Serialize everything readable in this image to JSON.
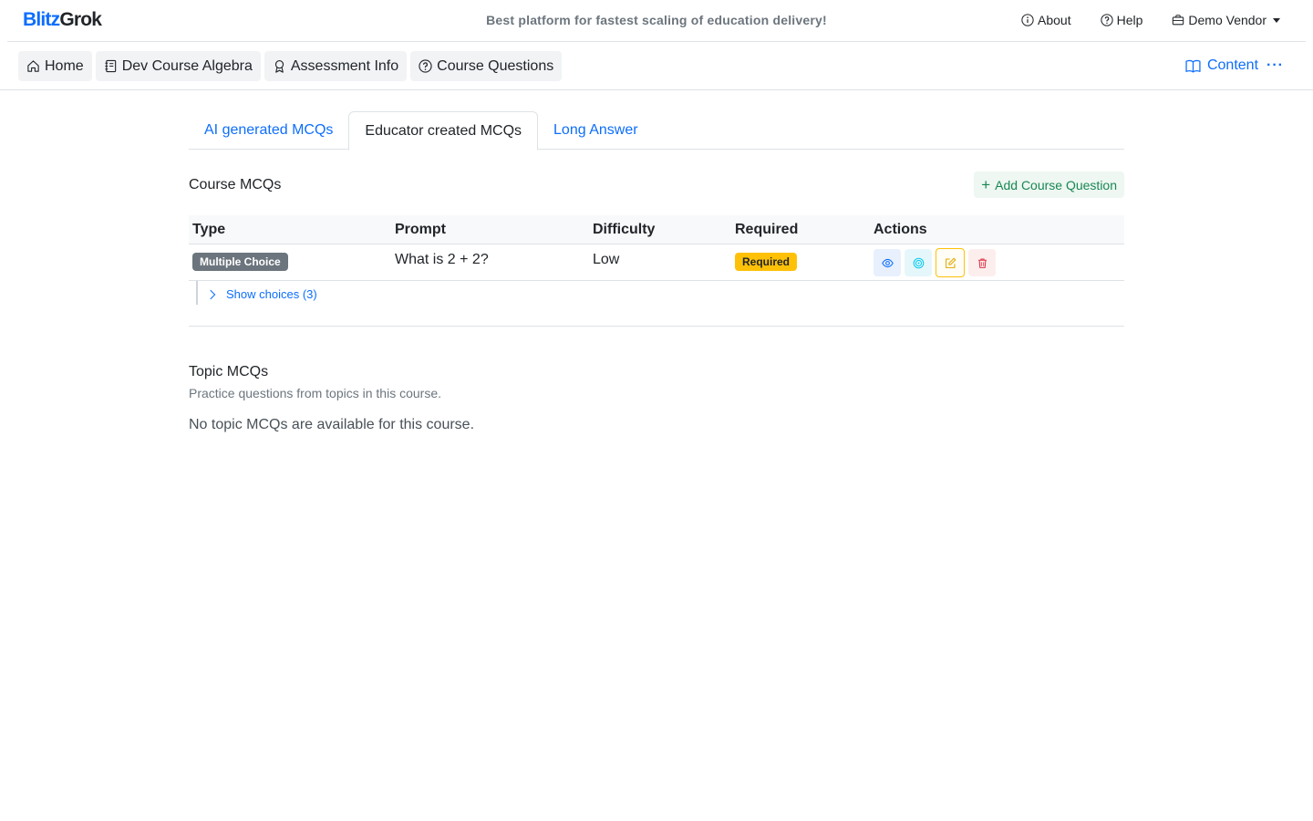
{
  "brand": {
    "part1": "Blitz",
    "part2": "Grok"
  },
  "tagline": "Best platform for fastest scaling of education delivery!",
  "top_links": {
    "about": "About",
    "help": "Help",
    "vendor": "Demo Vendor"
  },
  "breadcrumbs": [
    {
      "label": "Home",
      "icon": "house-icon"
    },
    {
      "label": "Dev Course Algebra",
      "icon": "journal-icon"
    },
    {
      "label": "Assessment Info",
      "icon": "award-icon"
    },
    {
      "label": "Course Questions",
      "icon": "question-circle-icon"
    }
  ],
  "content_menu": {
    "label": "Content",
    "more": "···"
  },
  "tabs": [
    {
      "label": "AI generated MCQs",
      "active": false
    },
    {
      "label": "Educator created MCQs",
      "active": true
    },
    {
      "label": "Long Answer",
      "active": false
    }
  ],
  "course_mcqs": {
    "title": "Course MCQs",
    "add_button": "Add Course Question",
    "columns": [
      "Type",
      "Prompt",
      "Difficulty",
      "Required",
      "Actions"
    ],
    "rows": [
      {
        "type": "Multiple Choice",
        "prompt": "What is 2 + 2?",
        "difficulty": "Low",
        "required": "Required",
        "choices_toggle": "Show choices (3)"
      }
    ]
  },
  "topic_mcqs": {
    "title": "Topic MCQs",
    "subtitle": "Practice questions from topics in this course.",
    "empty": "No topic MCQs are available for this course."
  },
  "colors": {
    "primary": "#0d6efd",
    "success": "#198754",
    "warning": "#ffc107",
    "danger": "#dc3545",
    "info": "#0dcaf0",
    "secondary": "#6c757d"
  }
}
